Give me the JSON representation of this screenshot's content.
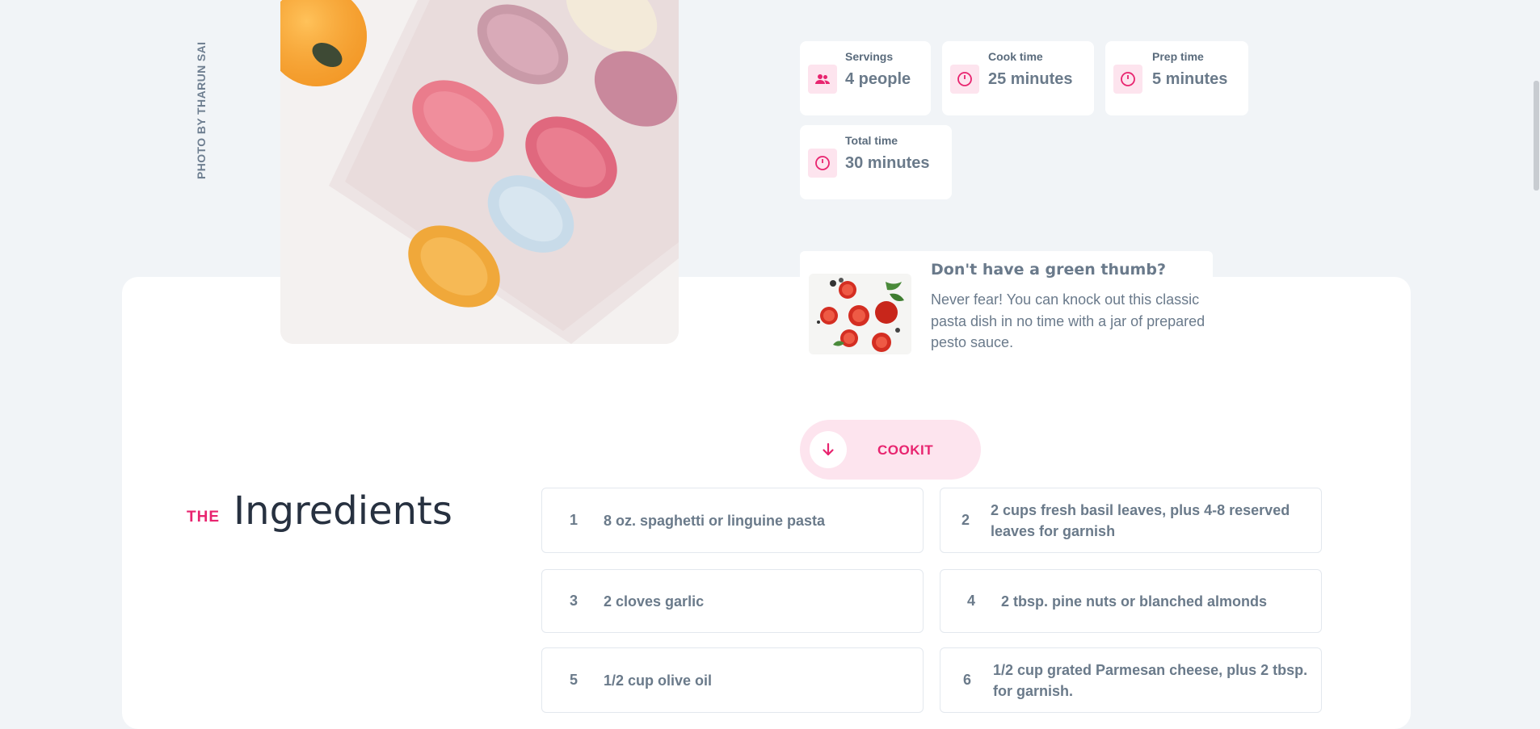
{
  "photo": {
    "credit": "PHOTO BY THARUN SAI"
  },
  "stats": {
    "servings": {
      "label": "Servings",
      "value": "4 people",
      "icon": "people-icon"
    },
    "cook_time": {
      "label": "Cook time",
      "value": "25 minutes",
      "icon": "clock-icon"
    },
    "prep_time": {
      "label": "Prep time",
      "value": "5 minutes",
      "icon": "clock-icon"
    },
    "total_time": {
      "label": "Total time",
      "value": "30 minutes",
      "icon": "clock-icon"
    }
  },
  "tip": {
    "title": "Don't have a green thumb?",
    "text": "Never fear! You can knock out this classic pasta dish in no time with a jar of prepared pesto sauce."
  },
  "cookit": {
    "label": "COOKIT",
    "icon": "arrow-down-icon"
  },
  "ingredients": {
    "prefix": "THE",
    "title": "Ingredients",
    "items": [
      {
        "num": "1",
        "text": "8 oz. spaghetti or linguine pasta"
      },
      {
        "num": "2",
        "text": "2 cups fresh basil leaves, plus 4-8 reserved leaves for garnish"
      },
      {
        "num": "3",
        "text": "2 cloves garlic"
      },
      {
        "num": "4",
        "text": "2 tbsp. pine nuts or blanched almonds"
      },
      {
        "num": "5",
        "text": "1/2 cup olive oil"
      },
      {
        "num": "6",
        "text": "1/2 cup grated Parmesan cheese, plus 2 tbsp. for garnish."
      }
    ]
  },
  "colors": {
    "accent": "#e8246f",
    "accent_soft": "#fde4ee",
    "background": "#f1f4f7",
    "heading": "#273140",
    "text": "#6a7a8a"
  }
}
